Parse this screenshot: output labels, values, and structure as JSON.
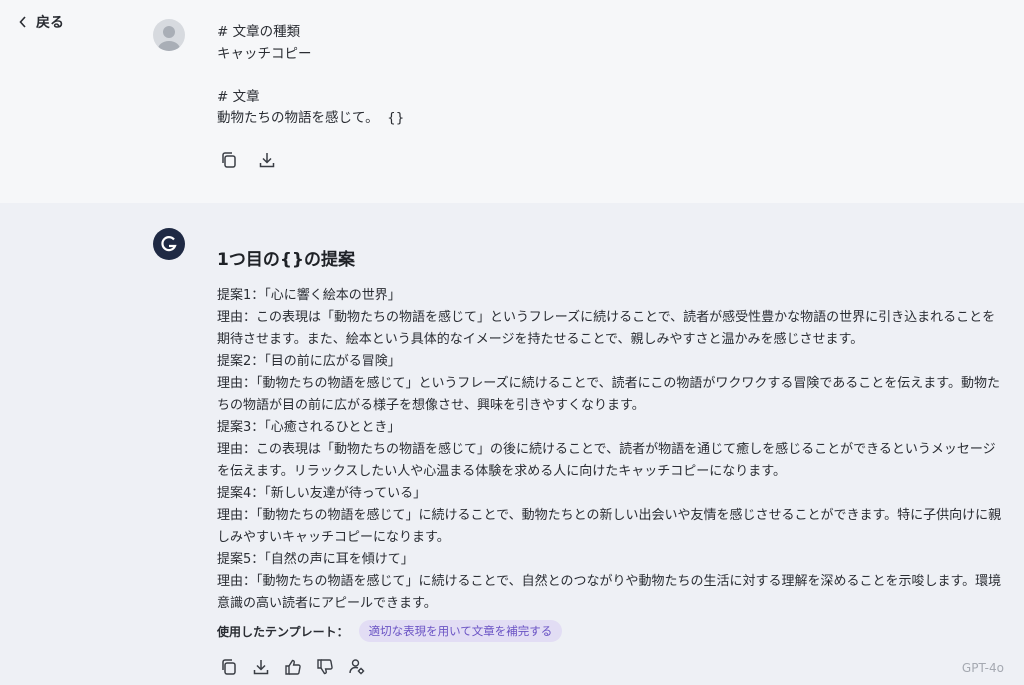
{
  "nav": {
    "back_label": "戻る"
  },
  "user_message": {
    "lines": [
      "# 文章の種類",
      "キャッチコピー",
      "",
      "# 文章",
      "動物たちの物語を感じて。  {}"
    ]
  },
  "assistant_message": {
    "title": "1つ目の{}の提案",
    "paragraphs": [
      "提案1：「心に響く絵本の世界」",
      "理由：この表現は「動物たちの物語を感じて」というフレーズに続けることで、読者が感受性豊かな物語の世界に引き込まれることを期待させます。また、絵本という具体的なイメージを持たせることで、親しみやすさと温かみを感じさせます。",
      "提案2：「目の前に広がる冒険」",
      "理由：「動物たちの物語を感じて」というフレーズに続けることで、読者にこの物語がワクワクする冒険であることを伝えます。動物たちの物語が目の前に広がる様子を想像させ、興味を引きやすくなります。",
      "提案3：「心癒されるひととき」",
      "理由：この表現は「動物たちの物語を感じて」の後に続けることで、読者が物語を通じて癒しを感じることができるというメッセージを伝えます。リラックスしたい人や心温まる体験を求める人に向けたキャッチコピーになります。",
      "提案4：「新しい友達が待っている」",
      "理由：「動物たちの物語を感じて」に続けることで、動物たちとの新しい出会いや友情を感じさせることができます。特に子供向けに親しみやすいキャッチコピーになります。",
      "提案5：「自然の声に耳を傾けて」",
      "理由：「動物たちの物語を感じて」に続けることで、自然とのつながりや動物たちの生活に対する理解を深めることを示唆します。環境意識の高い読者にアピールできます。"
    ],
    "template_label": "使用したテンプレート：",
    "template_chip": "適切な表現を用いて文章を補完する",
    "model": "GPT-4o"
  },
  "colors": {
    "user_bg": "#f6f7f9",
    "assistant_bg": "#eef0f5",
    "chip_bg": "#e2ddf4",
    "chip_text": "#6a53c4",
    "bot_avatar": "#1f2a44"
  },
  "icons": {
    "back": "chevron-left-icon",
    "copy": "copy-icon",
    "download": "download-icon",
    "thumbs_up": "thumbs-up-icon",
    "thumbs_down": "thumbs-down-icon",
    "settings": "user-settings-icon"
  }
}
